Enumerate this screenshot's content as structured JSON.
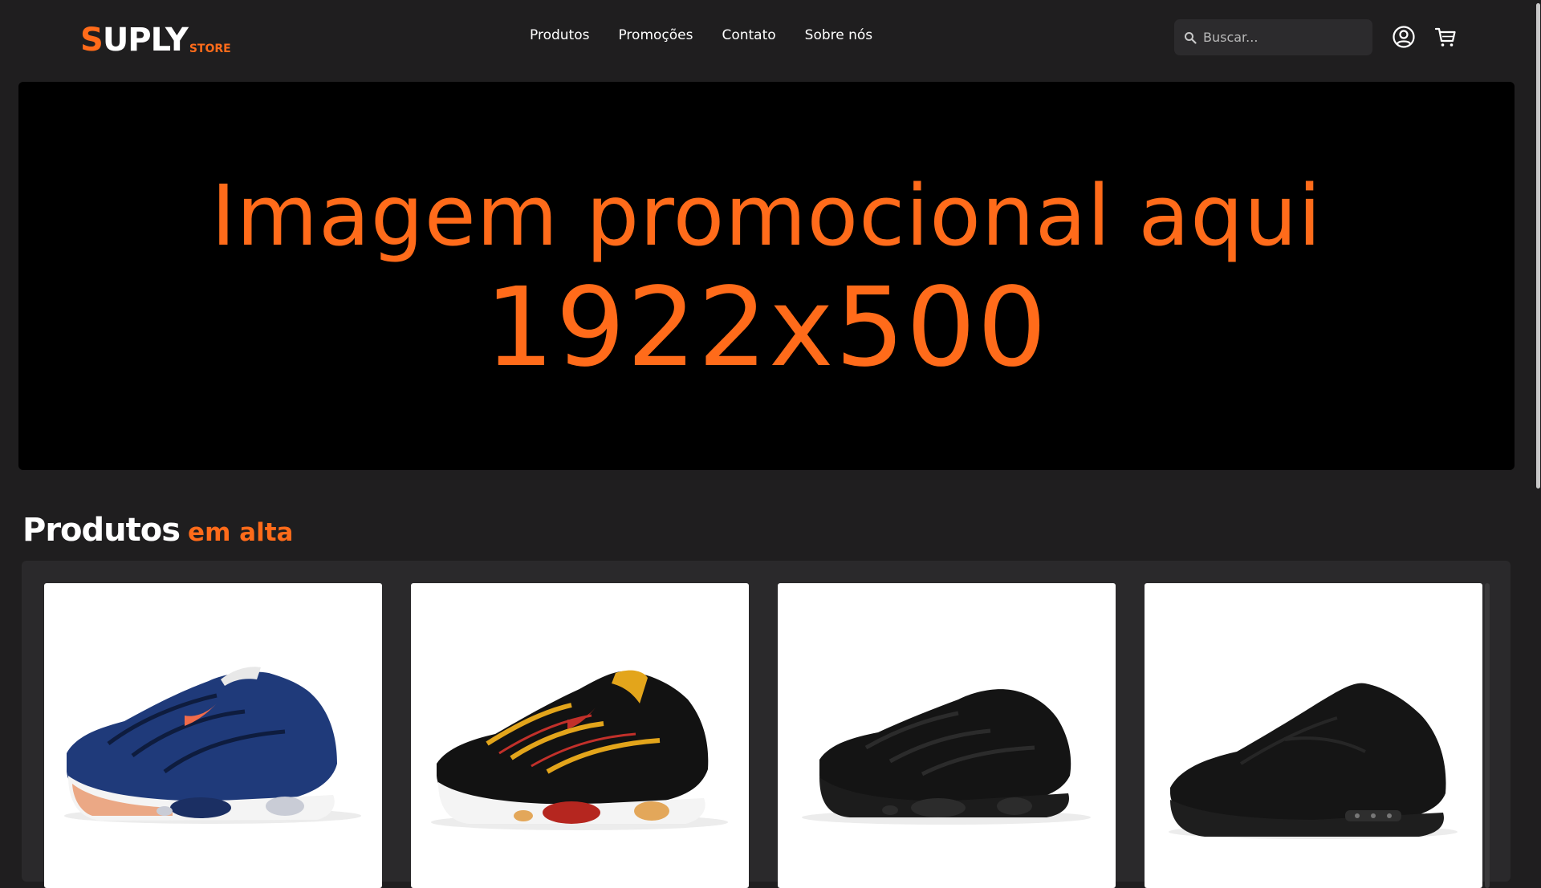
{
  "brand": {
    "name_first": "S",
    "name_rest": "UPLY",
    "sub": "STORE",
    "accent": "#ff6b1a"
  },
  "nav": {
    "items": [
      {
        "label": "Produtos"
      },
      {
        "label": "Promoções"
      },
      {
        "label": "Contato"
      },
      {
        "label": "Sobre nós"
      }
    ]
  },
  "search": {
    "placeholder": "Buscar..."
  },
  "header_icons": {
    "account": "user-icon",
    "cart": "cart-icon",
    "search": "search-icon"
  },
  "banner": {
    "line1": "Imagem promocional aqui",
    "line2": "1922x500"
  },
  "section": {
    "title_main": "Produtos",
    "title_accent": "em alta"
  },
  "products": [
    {
      "image": "sneaker-blue-icon",
      "colors": [
        "#1d3472",
        "#e85a3a"
      ]
    },
    {
      "image": "sneaker-black-yellow-icon",
      "colors": [
        "#111111",
        "#e0a31c"
      ]
    },
    {
      "image": "sneaker-black-plus-icon",
      "colors": [
        "#151515",
        "#2a2a2a"
      ]
    },
    {
      "image": "sneaker-black-90-icon",
      "colors": [
        "#141414",
        "#262626"
      ]
    }
  ],
  "colors": {
    "background": "#1f1e1f",
    "panel": "#2a292b",
    "search_bg": "#2c2b2d"
  }
}
